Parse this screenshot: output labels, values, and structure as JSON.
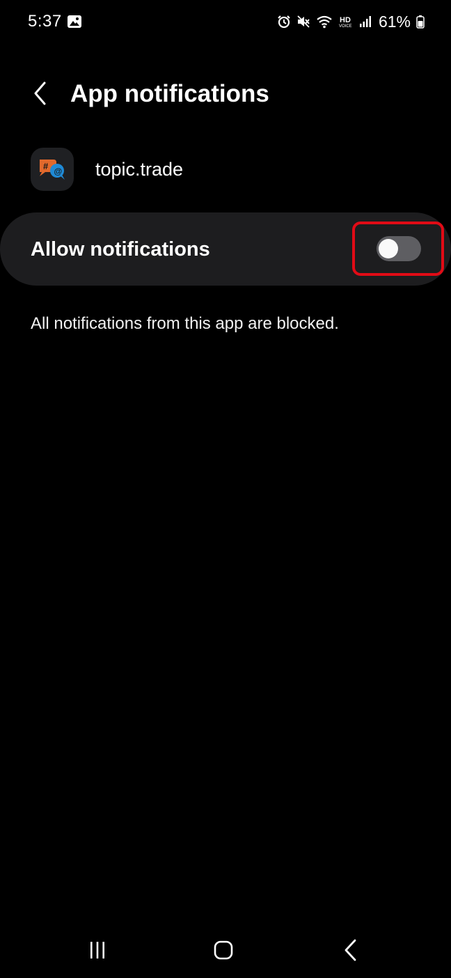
{
  "status_bar": {
    "time": "5:37",
    "battery": "61%",
    "icons": [
      "gallery-icon",
      "alarm-icon",
      "mute-icon",
      "wifi-icon",
      "hd-voice-icon",
      "signal-icon",
      "battery-icon"
    ]
  },
  "header": {
    "title": "App notifications",
    "back_icon": "chevron-left-icon"
  },
  "app": {
    "name": "topic.trade",
    "icon": "topic-trade-app-icon"
  },
  "allow_notifications": {
    "label": "Allow notifications",
    "enabled": false
  },
  "blocked_message": "All notifications from this app are blocked.",
  "nav_bar": {
    "icons": [
      "recents-icon",
      "home-icon",
      "back-icon"
    ]
  },
  "colors": {
    "background": "#000000",
    "card": "#1d1d1f",
    "toggle_off": "#5e5e62",
    "highlight": "#e10b16"
  }
}
